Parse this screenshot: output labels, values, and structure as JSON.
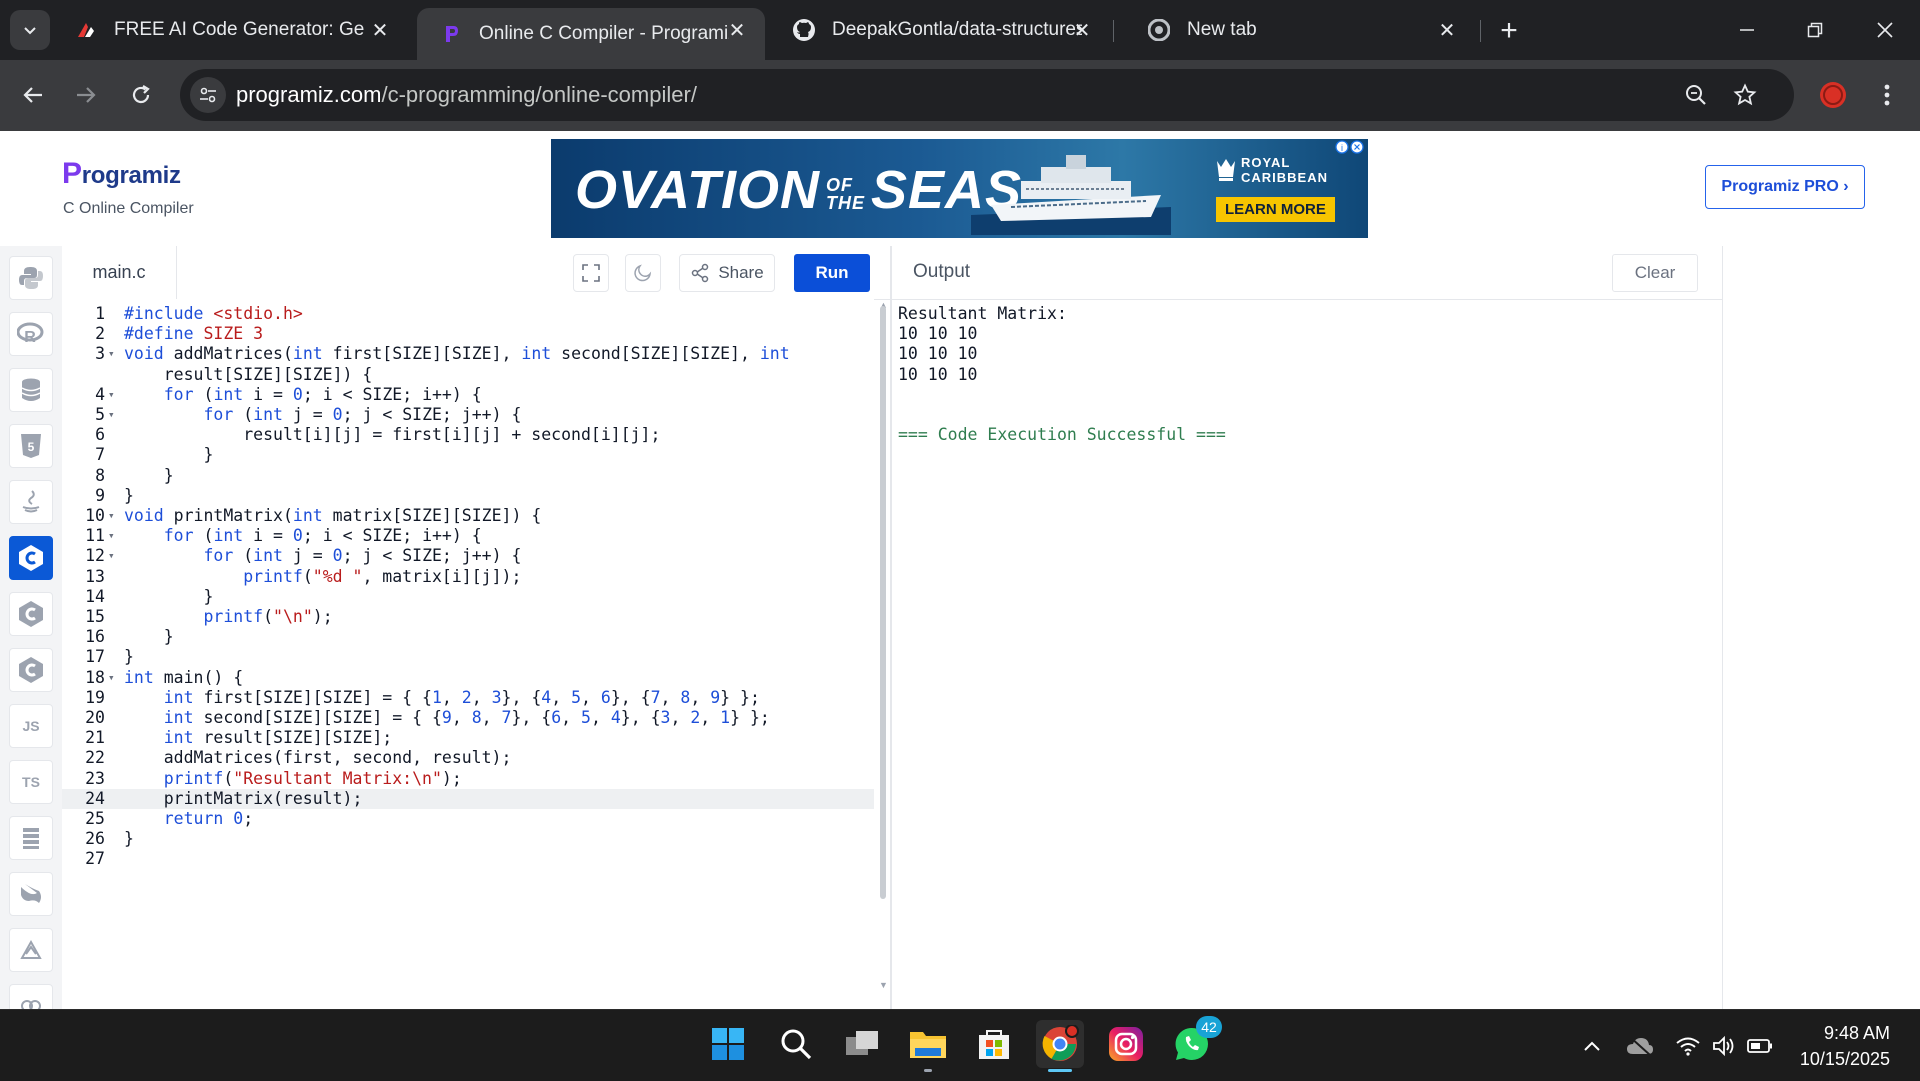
{
  "browser": {
    "tabs": [
      {
        "title": "FREE AI Code Generator: Gener",
        "active": false
      },
      {
        "title": "Online C Compiler - Programiz",
        "active": true
      },
      {
        "title": "DeepakGontla/data-structures-i",
        "active": false
      },
      {
        "title": "New tab",
        "active": false
      }
    ],
    "url_host": "programiz.com",
    "url_path": "/c-programming/online-compiler/"
  },
  "header": {
    "logo": "rogramiz",
    "logo_p": "P",
    "subtitle": "C Online Compiler",
    "ad": {
      "title_a": "OVATION",
      "title_of": "OF",
      "title_the": "THE",
      "title_b": "SEAS",
      "brand_line1": "ROYAL",
      "brand_line2": "CARIBBEAN",
      "cta": "LEARN MORE"
    },
    "pro_button": "Programiz PRO ›"
  },
  "sidebar": {
    "languages": [
      {
        "name": "python",
        "label": ""
      },
      {
        "name": "r",
        "label": "R"
      },
      {
        "name": "sql",
        "label": ""
      },
      {
        "name": "html",
        "label": "5"
      },
      {
        "name": "java",
        "label": ""
      },
      {
        "name": "c",
        "label": "C",
        "active": true
      },
      {
        "name": "cpp",
        "label": "C"
      },
      {
        "name": "csharp",
        "label": "C"
      },
      {
        "name": "js",
        "label": "JS"
      },
      {
        "name": "ts",
        "label": "TS"
      },
      {
        "name": "go",
        "label": ""
      },
      {
        "name": "php",
        "label": ""
      },
      {
        "name": "swift",
        "label": ""
      },
      {
        "name": "rust",
        "label": ""
      }
    ]
  },
  "editor": {
    "filename": "main.c",
    "share_label": "Share",
    "run_label": "Run",
    "active_line": 24,
    "lines": [
      "#include <stdio.h>",
      "#define SIZE 3",
      "void addMatrices(int first[SIZE][SIZE], int second[SIZE][SIZE], int",
      "    result[SIZE][SIZE]) {",
      "    for (int i = 0; i < SIZE; i++) {",
      "        for (int j = 0; j < SIZE; j++) {",
      "            result[i][j] = first[i][j] + second[i][j];",
      "        }",
      "    }",
      "}",
      "void printMatrix(int matrix[SIZE][SIZE]) {",
      "    for (int i = 0; i < SIZE; i++) {",
      "        for (int j = 0; j < SIZE; j++) {",
      "            printf(\"%d \", matrix[i][j]);",
      "        }",
      "        printf(\"\\n\");",
      "    }",
      "}",
      "int main() {",
      "    int first[SIZE][SIZE] = { {1, 2, 3}, {4, 5, 6}, {7, 8, 9} };",
      "    int second[SIZE][SIZE] = { {9, 8, 7}, {6, 5, 4}, {3, 2, 1} };",
      "    int result[SIZE][SIZE];",
      "    addMatrices(first, second, result);",
      "    printf(\"Resultant Matrix:\\n\");",
      "    printMatrix(result);",
      "    return 0;",
      "}",
      ""
    ],
    "line_numbers": [
      "1",
      "2",
      "3",
      "",
      "4",
      "5",
      "6",
      "7",
      "8",
      "9",
      "10",
      "11",
      "12",
      "13",
      "14",
      "15",
      "16",
      "17",
      "18",
      "19",
      "20",
      "21",
      "22",
      "23",
      "24",
      "25",
      "26",
      "27"
    ],
    "fold_markers": [
      false,
      false,
      true,
      false,
      true,
      true,
      false,
      false,
      false,
      false,
      true,
      true,
      true,
      false,
      false,
      false,
      false,
      false,
      true,
      false,
      false,
      false,
      false,
      false,
      false,
      false,
      false,
      false
    ]
  },
  "output": {
    "title": "Output",
    "clear_label": "Clear",
    "lines": [
      {
        "text": "Resultant Matrix:",
        "type": "normal"
      },
      {
        "text": "10 10 10",
        "type": "normal"
      },
      {
        "text": "10 10 10",
        "type": "normal"
      },
      {
        "text": "10 10 10",
        "type": "normal"
      },
      {
        "text": "",
        "type": "normal"
      },
      {
        "text": "",
        "type": "normal"
      },
      {
        "text": "=== Code Execution Successful ===",
        "type": "success"
      }
    ]
  },
  "taskbar": {
    "whatsapp_badge": "42",
    "time": "9:48 AM",
    "date": "10/15/2025"
  },
  "colors": {
    "accent": "#0b4fd8",
    "success": "#2f7d4f",
    "chrome_dark": "#202124"
  }
}
